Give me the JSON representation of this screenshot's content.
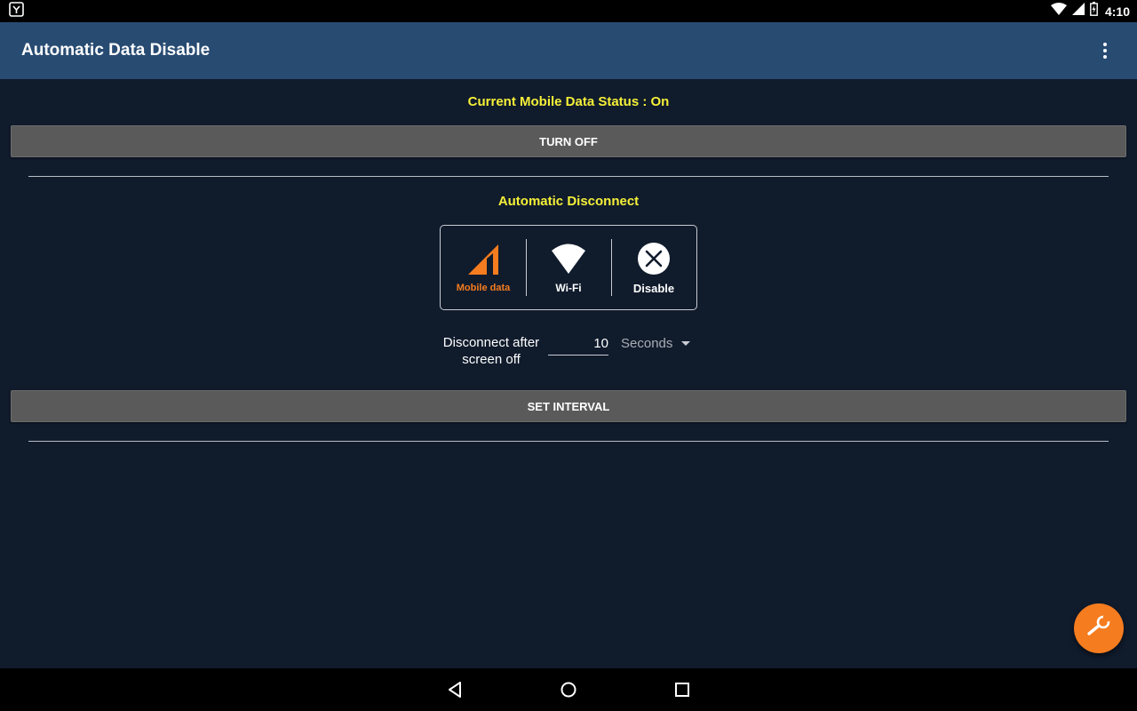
{
  "status_bar": {
    "time": "4:10",
    "icons": [
      "app-notification-icon",
      "wifi-icon",
      "cell-signal-icon",
      "battery-icon"
    ]
  },
  "app_bar": {
    "title": "Automatic Data Disable",
    "menu_icon": "more-vert-icon"
  },
  "main": {
    "status_text": "Current Mobile Data Status : On",
    "toggle_button_label": "TURN OFF",
    "section_title": "Automatic Disconnect",
    "modes": [
      {
        "label": "Mobile data",
        "icon": "mobile-data-icon",
        "selected": true
      },
      {
        "label": "Wi-Fi",
        "icon": "wifi-icon",
        "selected": false
      },
      {
        "label": "Disable",
        "icon": "cancel-icon",
        "selected": false
      }
    ],
    "interval": {
      "label_line1": "Disconnect after",
      "label_line2": "screen off",
      "value": "10",
      "unit": "Seconds"
    },
    "set_interval_label": "SET INTERVAL"
  },
  "fab": {
    "icon": "wrench-icon"
  },
  "nav_bar": {
    "icons": [
      "back-icon",
      "home-icon",
      "recents-icon"
    ]
  },
  "colors": {
    "background": "#101b2c",
    "app_bar": "#284b72",
    "accent_yellow": "#f5f038",
    "accent_orange": "#f57c1f",
    "button_gray": "#5a5a5a"
  }
}
